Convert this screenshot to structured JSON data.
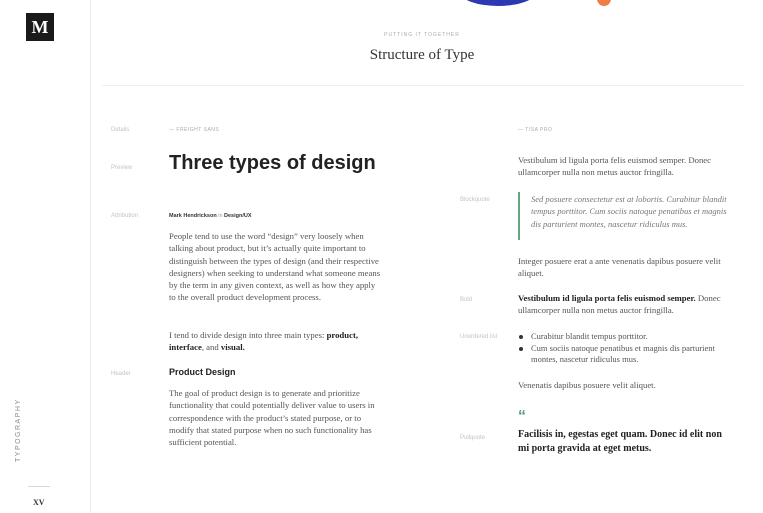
{
  "sidebar": {
    "logo": "M",
    "section_label": "TYPOGRAPHY",
    "page_number": "XV"
  },
  "header": {
    "eyebrow": "PUTTING IT TOGETHER",
    "title": "Structure of Type"
  },
  "labels": {
    "details": "Details",
    "preview": "Preview",
    "attribution": "Attribution",
    "header": "Header",
    "blockquote": "Blockquote",
    "bold": "Bold",
    "unordered_list": "Unordered list",
    "pullquote": "Pullquote"
  },
  "left_column": {
    "font_name": "— FREIGHT SANS",
    "title": "Three types of design",
    "author": "Mark Hendrickson",
    "in_word": " in ",
    "publication": "Design/UX",
    "p1": "People tend to use the word “design” very loosely when talking about product, but it’s actually quite important to distinguish between the types of design (and their respective designers) when seeking to understand what someone means by the term in any given context, as well as how they apply to the overall product development process.",
    "p2_start": "I tend to divide design into three main types: ",
    "p2_product": "product,",
    "p2_interface": "interface",
    "p2_and": ", and ",
    "p2_visual": "visual.",
    "subheading": "Product Design",
    "p3": "The goal of product design is to generate and prioritize functionality that could potentially deliver value to users in correspondence with the product’s stated purpose, or to modify that stated purpose when no such functionality has sufficient potential."
  },
  "right_column": {
    "font_name": "— TISA PRO",
    "p1": "Vestibulum id ligula porta felis euismod semper. Donec ullamcorper nulla non metus auctor fringilla.",
    "blockquote": "Sed posuere consectetur est at lobortis. Curabitur blandit tempus porttitor. Cum sociis natoque penatibus et magnis dis parturient montes, nascetur ridiculus mus.",
    "p2": "Integer posuere erat a ante venenatis dapibus posuere velit aliquet.",
    "bold_line": "Vestibulum id ligula porta felis euismod semper.",
    "bold_rest": " Donec ullamcorper nulla non metus auctor fringilla.",
    "bullets": [
      "Curabitur blandit tempus porttitor.",
      "Cum sociis natoque penatibus et magnis dis parturient montes, nascetur ridiculus mus."
    ],
    "p3": "Venenatis dapibus posuere velit aliquet.",
    "pullquote_mark": "“",
    "pullquote": "Facilisis in, egestas eget quam. Donec id elit non mi porta gravida at eget metus."
  },
  "colors": {
    "accent_green": "#4d9a72",
    "quote_bar": "#67a383",
    "logo_bg": "#1a1a1a"
  }
}
